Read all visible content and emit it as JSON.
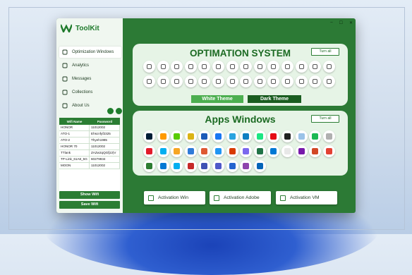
{
  "app": {
    "title": "ToolKit",
    "brand_color": "#2c7a35"
  },
  "titlebar": {
    "minimize": "–",
    "maximize": "☐",
    "close": "✕"
  },
  "sidebar": {
    "items": [
      {
        "label": "Optimization Windows",
        "icon": "home-icon",
        "active": true
      },
      {
        "label": "Analytics",
        "icon": "chart-icon"
      },
      {
        "label": "Messages",
        "icon": "chat-icon"
      },
      {
        "label": "Collections",
        "icon": "bookmark-icon"
      },
      {
        "label": "About Us",
        "icon": "people-icon"
      }
    ]
  },
  "wifi": {
    "headers": [
      "Wifi Name",
      "Password"
    ],
    "rows": [
      [
        "HONOR",
        "11012002"
      ],
      [
        "ATO-1",
        "Ehscnfyf2325"
      ],
      [
        "ATO-2",
        "Thyeh1985"
      ],
      [
        "HONOR 70",
        "11012002"
      ],
      [
        "TTlank",
        "ZAZw2qQGfjzz|V"
      ],
      [
        "TP-Link_61A8_5G",
        "60279934"
      ],
      [
        "MOON",
        "11012002"
      ]
    ],
    "show_button": "Show Wifi",
    "save_button": "Save Wifi"
  },
  "optimization": {
    "title": "OPTIMATION SYSTEM",
    "turn_all": "Turn all",
    "white_theme": "White Theme",
    "dark_theme": "Dark Theme",
    "icons": [
      "lock-icon",
      "shield-icon",
      "clipboard-icon",
      "users-icon",
      "bell-icon",
      "location-icon",
      "settings-icon",
      "grid-icon",
      "person-icon",
      "contact-icon",
      "search-icon",
      "history-icon",
      "phone-icon",
      "image-icon",
      "mail-icon",
      "accessibility-icon",
      "tablet-icon",
      "inbox-icon",
      "document-icon",
      "folder-icon",
      "folder-icon",
      "star-icon",
      "battery-icon",
      "refresh-icon",
      "pie-icon",
      "monitor-icon",
      "screen-icon",
      "video-icon"
    ]
  },
  "apps": {
    "title": "Apps Windows",
    "turn_all": "Turn all",
    "icons": [
      {
        "name": "photoshop-icon",
        "color": "#001e36"
      },
      {
        "name": "illustrator-icon",
        "color": "#ff9a00"
      },
      {
        "name": "duolingo-icon",
        "color": "#58cc02"
      },
      {
        "name": "chrome-icon",
        "color": "#dbb416"
      },
      {
        "name": "arrow-app-icon",
        "color": "#1b5ab8"
      },
      {
        "name": "facebook-icon",
        "color": "#1877f2"
      },
      {
        "name": "telegram-icon",
        "color": "#2aa3df"
      },
      {
        "name": "edge-icon",
        "color": "#0f7fc2"
      },
      {
        "name": "hulu-icon",
        "color": "#1ce783"
      },
      {
        "name": "streaming-icon",
        "color": "#e50914"
      },
      {
        "name": "play-icon",
        "color": "#222222"
      },
      {
        "name": "app-icon",
        "color": "#9ac2e8"
      },
      {
        "name": "spotify-icon",
        "color": "#1db954"
      },
      {
        "name": "music-icon",
        "color": "#b0b0b0"
      },
      {
        "name": "qbit-icon",
        "color": "#e21b2a"
      },
      {
        "name": "skype-icon",
        "color": "#00aff0"
      },
      {
        "name": "coin-icon",
        "color": "#f6a623"
      },
      {
        "name": "browser-icon",
        "color": "#2f7bd8"
      },
      {
        "name": "duck-icon",
        "color": "#de5833"
      },
      {
        "name": "photos-icon",
        "color": "#2196f3"
      },
      {
        "name": "office-icon",
        "color": "#d83b01"
      },
      {
        "name": "app-icon",
        "color": "#7b68ee"
      },
      {
        "name": "excel-icon",
        "color": "#217346"
      },
      {
        "name": "store-icon",
        "color": "#0078d4"
      },
      {
        "name": "news-icon",
        "color": "#e8e8e8"
      },
      {
        "name": "onenote-icon",
        "color": "#7719aa"
      },
      {
        "name": "powerpoint-icon",
        "color": "#d24726"
      },
      {
        "name": "maps-icon",
        "color": "#e34133"
      },
      {
        "name": "shield-app-icon",
        "color": "#2e7d32"
      },
      {
        "name": "outlook-icon",
        "color": "#0078d4"
      },
      {
        "name": "skype-icon",
        "color": "#00aff0"
      },
      {
        "name": "app-icon",
        "color": "#c62828"
      },
      {
        "name": "pdf-icon",
        "color": "#3f51b5"
      },
      {
        "name": "teams-icon",
        "color": "#5059c9"
      },
      {
        "name": "todo-icon",
        "color": "#2564cf"
      },
      {
        "name": "copilot-icon",
        "color": "#8e44ad"
      },
      {
        "name": "onedrive-icon",
        "color": "#0364b8"
      }
    ]
  },
  "activation": {
    "buttons": [
      "Activation Win",
      "Activation Adobe",
      "Activation VM"
    ]
  }
}
